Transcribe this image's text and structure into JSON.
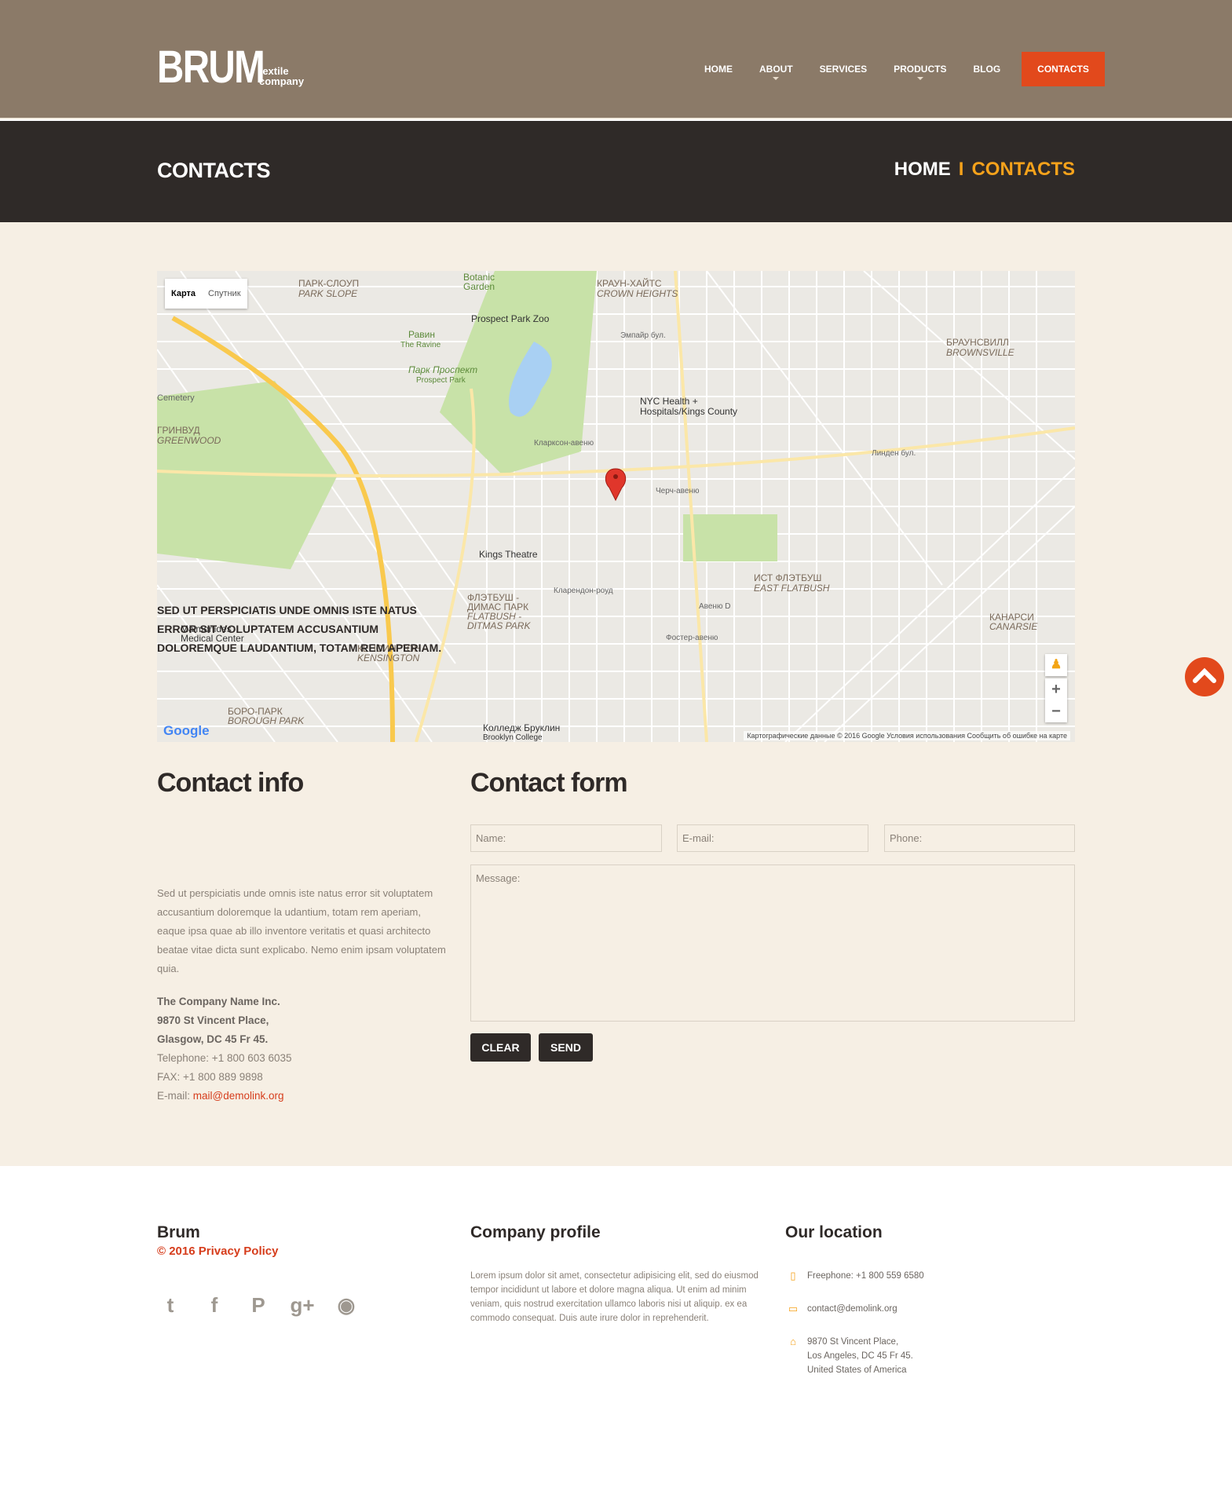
{
  "header": {
    "logo": "BRUM",
    "tagline_1": "textile",
    "tagline_2": "company",
    "nav": [
      "HOME",
      "ABOUT",
      "SERVICES",
      "PRODUCTS",
      "BLOG",
      "CONTACTS"
    ]
  },
  "titlebar": {
    "title": "CONTACTS",
    "crumb_home": "HOME",
    "crumb_sep": "I",
    "crumb_current": "CONTACTS"
  },
  "map": {
    "type_map": "Карта",
    "type_satellite": "Спутник",
    "credits": "Картографические данные © 2016 Google    Условия использования    Сообщить об ошибке на карте",
    "google": "Google",
    "zoom_in": "+",
    "zoom_out": "−",
    "labels": [
      "ПАРК-СЛОУП",
      "PARK SLOPE",
      "Botanic",
      "Garden",
      "КРАУН-ХАЙТС",
      "CROWN HEIGHTS",
      "Prospect Park Zoo",
      "Равин",
      "The Ravine",
      "Парк Проспект",
      "Prospect Park",
      "NYC Health +",
      "Hospitals/Kings County",
      "ГРИНВУД",
      "GREENWOOD",
      "Kings Theatre",
      "ФЛЭТБУШ -",
      "ДИМАС ПАРК",
      "FLATBUSH -",
      "DITMAS PARK",
      "ИСТ ФЛЭТБУШ",
      "EAST FLATBUSH",
      "БРАУНСВИЛЛ",
      "BROWNSVILLE",
      "Maimonides",
      "Medical Center",
      "КЕНСИНГТОН",
      "KENSINGTON",
      "КАНАРСИ",
      "CANARSIE",
      "БОРО-ПАРК",
      "BOROUGH PARK",
      "Колледж Бруклин",
      "Brooklyn College",
      "Кларксон-авеню",
      "Черч-авеню",
      "Кларендон-роуд",
      "Авеню D",
      "Фостер-авеню",
      "Эмпайр бул.",
      "Линден бул.",
      "Cemetery"
    ]
  },
  "contact_info": {
    "heading": "Contact info",
    "lead": "SED UT PERSPICIATIS UNDE OMNIS ISTE NATUS ERROR SIT VOLUPTATEM ACCUSANTIUM DOLOREMQUE LAUDANTIUM, TOTAM REM APERIAM.",
    "body": "Sed ut perspiciatis unde omnis iste natus error sit voluptatem accusantium doloremque la udantium, totam rem aperiam, eaque ipsa quae ab illo inventore veritatis et quasi architecto beatae vitae dicta sunt explicabo. Nemo enim ipsam voluptatem quia.",
    "company": "The Company Name Inc.",
    "street": "9870 St Vincent Place,",
    "city": "Glasgow, DC 45 Fr 45.",
    "telephone": "Telephone: +1 800 603 6035",
    "fax": "FAX: +1 800 889 9898",
    "email_label": "E-mail:",
    "email": "mail@demolink.org"
  },
  "contact_form": {
    "heading": "Contact form",
    "name_ph": "Name:",
    "email_ph": "E-mail:",
    "phone_ph": "Phone:",
    "message_ph": "Message:",
    "clear": "CLEAR",
    "send": "SEND"
  },
  "footer": {
    "brand": "Brum",
    "copyright": "© 2016 Privacy Policy",
    "social_icons": [
      "twitter-icon",
      "facebook-icon",
      "pinterest-icon",
      "google-plus-icon",
      "github-icon"
    ],
    "profile_heading": "Company profile",
    "profile_text": "Lorem ipsum dolor sit amet, consectetur adipisicing elit, sed do eiusmod tempor incididunt ut labore et dolore magna aliqua. Ut enim ad minim veniam, quis nostrud exercitation ullamco laboris nisi ut aliquip. ex ea commodo consequat. Duis aute irure dolor in reprehenderit.",
    "location_heading": "Our location",
    "freephone": "Freephone: +1 800 559 6580",
    "email": "contact@demolink.org",
    "address_1": "9870 St Vincent Place,",
    "address_2": "Los Angeles, DC 45 Fr 45.",
    "address_3": "United States of America"
  },
  "colors": {
    "accent": "#e2491c",
    "header_bg": "#8b7a68",
    "titlebar_bg": "#2f2a28",
    "content_bg": "#f6efe4",
    "breadcrumb": "#f5a21b"
  }
}
